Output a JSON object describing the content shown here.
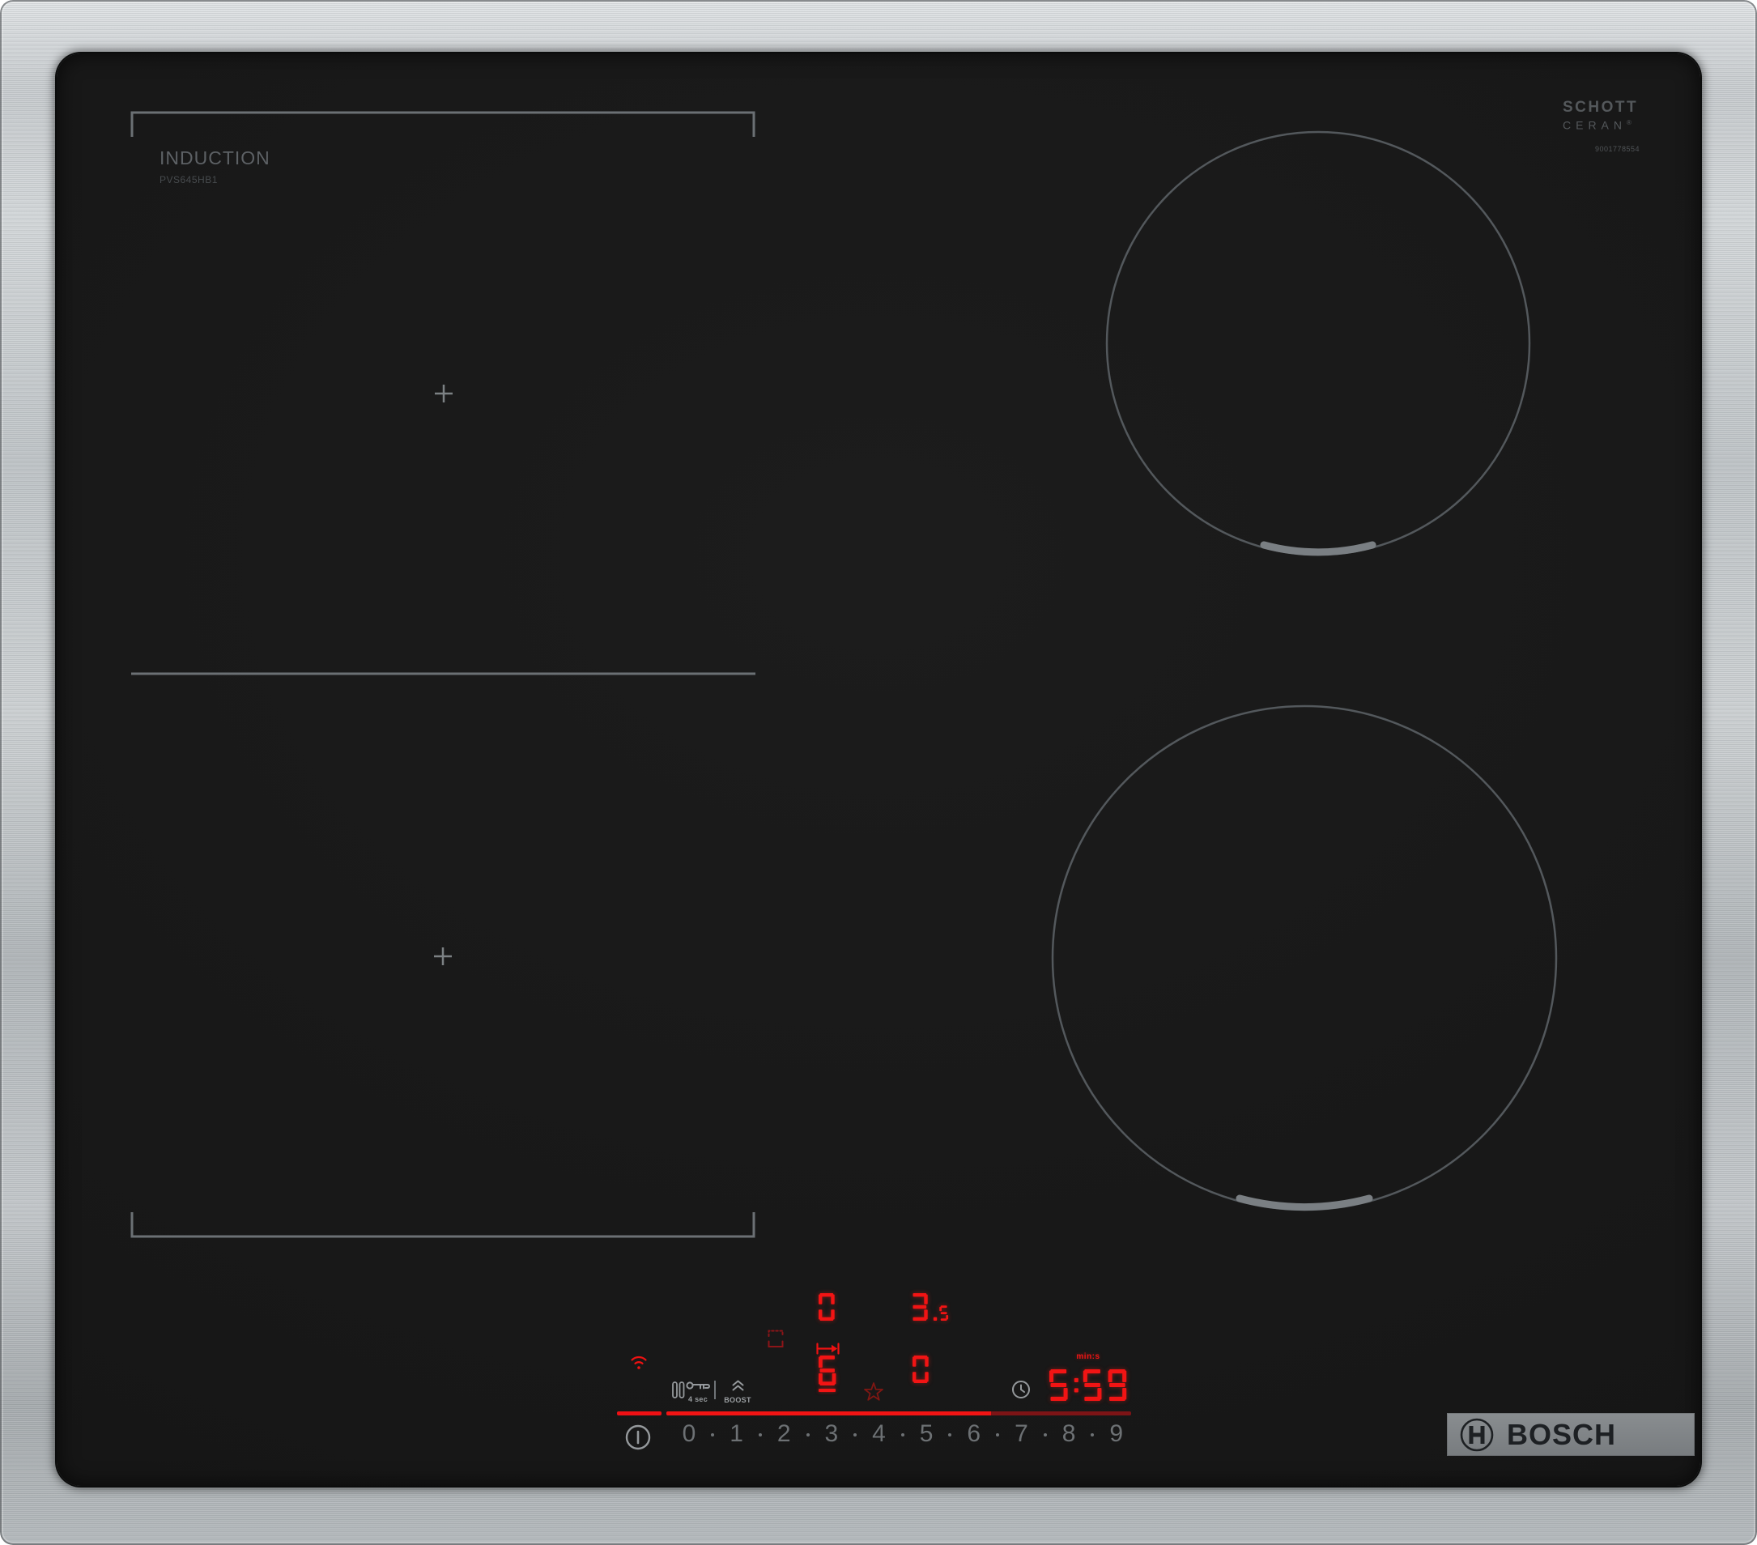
{
  "surface": {
    "type_label": "INDUCTION",
    "model": "PVS645HB1",
    "glass_brand": {
      "line1": "SCHOTT",
      "line2": "CERAN",
      "reg": "®",
      "code": "9001778554"
    },
    "logo_text": "BOSCH"
  },
  "controls": {
    "pause_hold_label": "4 sec",
    "boost_label": "BOOST",
    "timer_unit_label": "min:s",
    "displays": {
      "zone_rear_left": "0",
      "zone_rear_right": "3.5",
      "zone_front_left": "6",
      "zone_front_right": "0",
      "timer": "5:59"
    },
    "power_levels": [
      "0",
      "1",
      "2",
      "3",
      "4",
      "5",
      "6",
      "7",
      "8",
      "9"
    ],
    "selected_level": 6
  },
  "colors": {
    "display_red": "#f21414",
    "dim_red": "#7d1416",
    "icon_gray": "#95999c",
    "marking_gray": "#6b7074",
    "steel": "#c3c7ca"
  },
  "icons": {
    "wifi-icon": "home-connect wifi arcs",
    "pause-icon": "‖",
    "child-lock-key-icon": "key",
    "boost-chevrons-icon": "double chevron up",
    "flex-zone-indicator-icon": "dashed/solid brackets",
    "transfer-arrow-icon": "|→|",
    "favorite-star-icon": "☆",
    "timer-clock-icon": "clock",
    "power-icon": "circle with bar",
    "bosch-symbol-icon": "armature in circle"
  }
}
